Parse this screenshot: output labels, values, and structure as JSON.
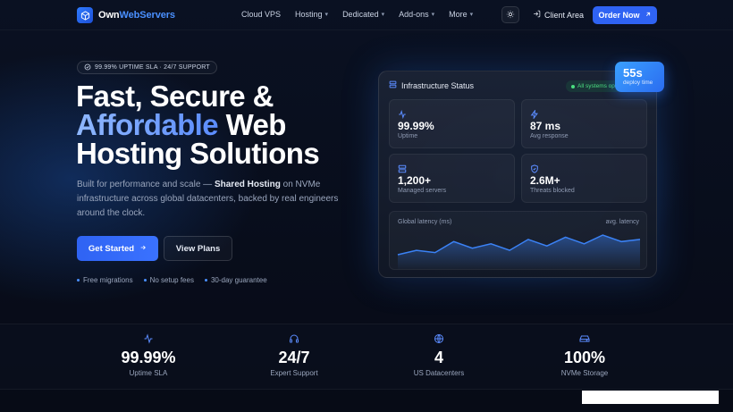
{
  "brand": {
    "name_prefix": "Own",
    "name_accent": "WebServers"
  },
  "nav": {
    "links": [
      "Cloud VPS",
      "Hosting",
      "Dedicated",
      "Add-ons",
      "More"
    ],
    "client_area": "Client Area",
    "order_now": "Order Now"
  },
  "hero": {
    "badge": "99.99% UPTIME SLA · 24/7 SUPPORT",
    "headline_line1": "Fast, Secure &",
    "headline_accent": "Affordable",
    "headline_line2_rest": " Web",
    "headline_line3": "Hosting Solutions",
    "sub_before": "Built for performance and scale — ",
    "sub_bold": "Shared Hosting",
    "sub_after": " on NVMe infrastructure across global datacenters, backed by real engineers around the clock.",
    "cta_primary": "Get Started",
    "cta_secondary": "View Plans",
    "perks": [
      "Free migrations",
      "No setup fees",
      "30-day guarantee"
    ]
  },
  "status_card": {
    "title": "Infrastructure Status",
    "pill": "All systems op",
    "deploy_value": "55s",
    "deploy_label": "deploy time",
    "tiles": [
      {
        "icon": "activity-icon",
        "value": "99.99%",
        "label": "Uptime"
      },
      {
        "icon": "zap-icon",
        "value": "87 ms",
        "label": "Avg response"
      },
      {
        "icon": "server-icon",
        "value": "1,200+",
        "label": "Managed servers"
      },
      {
        "icon": "shield-icon",
        "value": "2.6M+",
        "label": "Threats blocked"
      }
    ],
    "latency_title": "Global latency (ms)",
    "latency_caption": "avg. latency",
    "latency_values": [
      8,
      10,
      9,
      14,
      11,
      13,
      10,
      15,
      12,
      16,
      13,
      17,
      14,
      15
    ]
  },
  "stats": [
    {
      "icon": "activity-icon",
      "value": "99.99%",
      "label": "Uptime SLA"
    },
    {
      "icon": "headset-icon",
      "value": "24/7",
      "label": "Expert Support"
    },
    {
      "icon": "globe-icon",
      "value": "4",
      "label": "US Datacenters"
    },
    {
      "icon": "drive-icon",
      "value": "100%",
      "label": "NVMe Storage"
    }
  ],
  "colors": {
    "accent": "#2f63f3",
    "bg": "#070c18",
    "success": "#4ade80"
  }
}
